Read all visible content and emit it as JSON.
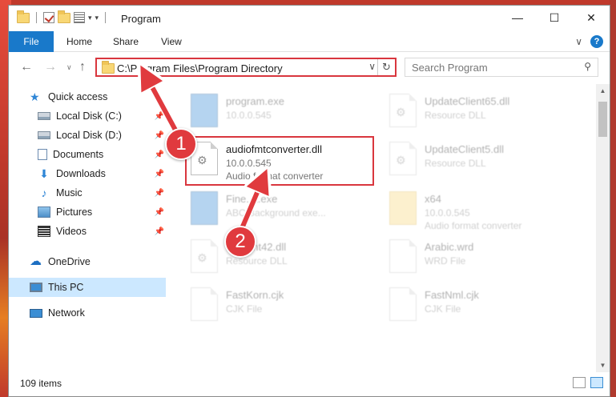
{
  "window": {
    "title": "Program",
    "controls": {
      "minimize": "—",
      "maximize": "☐",
      "close": "✕"
    }
  },
  "ribbon": {
    "tabs": [
      "File",
      "Home",
      "Share",
      "View"
    ],
    "expand_glyph": "∨",
    "help_glyph": "?"
  },
  "address_bar": {
    "path": "C:\\Program Files\\Program Directory",
    "dropdown_glyph": "∨",
    "refresh_glyph": "↻"
  },
  "search": {
    "placeholder": "Search Program",
    "icon_glyph": "⚲"
  },
  "nav_buttons": {
    "back": "←",
    "forward": "→",
    "recent": "∨",
    "up": "↑"
  },
  "sidebar": {
    "items": [
      {
        "label": "Quick access",
        "icon": "star-icon",
        "pinned": false
      },
      {
        "label": "Local Disk (C:)",
        "icon": "disk-icon",
        "pinned": true
      },
      {
        "label": "Local Disk (D:)",
        "icon": "disk-icon",
        "pinned": true
      },
      {
        "label": "Documents",
        "icon": "document-icon",
        "pinned": true
      },
      {
        "label": "Downloads",
        "icon": "download-icon",
        "pinned": true
      },
      {
        "label": "Music",
        "icon": "music-icon",
        "pinned": true
      },
      {
        "label": "Pictures",
        "icon": "pictures-icon",
        "pinned": true
      },
      {
        "label": "Videos",
        "icon": "videos-icon",
        "pinned": true
      },
      {
        "label": "OneDrive",
        "icon": "cloud-icon",
        "pinned": false
      },
      {
        "label": "This PC",
        "icon": "computer-icon",
        "pinned": false,
        "selected": true
      },
      {
        "label": "Network",
        "icon": "network-icon",
        "pinned": false
      }
    ],
    "pin_glyph": "📌"
  },
  "files": [
    {
      "name": "program.exe",
      "meta": "10.0.0.545",
      "desc": "",
      "icon": "exe-icon",
      "faded": true
    },
    {
      "name": "UpdateClient65.dll",
      "meta": "Resource DLL",
      "desc": "",
      "icon": "dll-icon",
      "faded": true
    },
    {
      "name": "audiofmtconverter.dll",
      "meta": "10.0.0.545",
      "desc": "Audio format converter",
      "icon": "dll-icon",
      "faded": false,
      "highlighted": true
    },
    {
      "name": "UpdateClient5.dll",
      "meta": "Resource DLL",
      "desc": "",
      "icon": "dll-icon",
      "faded": true
    },
    {
      "name": "Fine...t.exe",
      "meta": "ABC Background exe...",
      "desc": "",
      "icon": "exe-icon",
      "faded": true
    },
    {
      "name": "x64",
      "meta": "10.0.0.545",
      "desc": "Audio format converter",
      "icon": "folder-icon",
      "faded": true
    },
    {
      "name": "...Client42.dll",
      "meta": "Resource DLL",
      "desc": "",
      "icon": "dll-icon",
      "faded": true
    },
    {
      "name": "Arabic.wrd",
      "meta": "WRD File",
      "desc": "",
      "icon": "file-icon",
      "faded": true
    },
    {
      "name": "FastKorn.cjk",
      "meta": "CJK File",
      "desc": "",
      "icon": "file-icon",
      "faded": true
    },
    {
      "name": "FastNml.cjk",
      "meta": "CJK File",
      "desc": "",
      "icon": "file-icon",
      "faded": true
    }
  ],
  "status_bar": {
    "item_count": "109 items"
  },
  "annotations": {
    "step1": "1",
    "step2": "2",
    "color": "#e03a3e"
  }
}
